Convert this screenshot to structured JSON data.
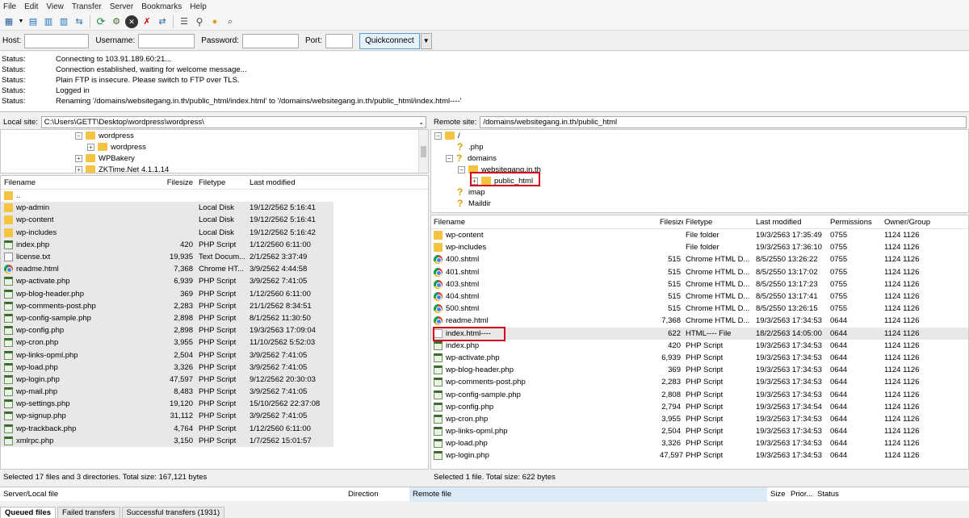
{
  "menu": [
    "File",
    "Edit",
    "View",
    "Transfer",
    "Server",
    "Bookmarks",
    "Help"
  ],
  "quickconnect": {
    "host_label": "Host:",
    "username_label": "Username:",
    "password_label": "Password:",
    "port_label": "Port:",
    "button_label": "Quickconnect",
    "host_value": "",
    "username_value": "",
    "password_value": "",
    "port_value": ""
  },
  "messages": [
    {
      "k": "Status:",
      "v": "Connecting to 103.91.189.60:21..."
    },
    {
      "k": "Status:",
      "v": "Connection established, waiting for welcome message..."
    },
    {
      "k": "Status:",
      "v": "Plain FTP is insecure. Please switch to FTP over TLS."
    },
    {
      "k": "Status:",
      "v": "Logged in"
    },
    {
      "k": "Status:",
      "v": "Renaming '/domains/websitegang.in.th/public_html/index.html' to '/domains/websitegang.in.th/public_html/index.html----'"
    }
  ],
  "local": {
    "site_label": "Local site:",
    "path": "C:\\Users\\GETT\\Desktop\\wordpress\\wordpress\\",
    "tree": [
      "wordpress",
      "wordpress",
      "WPBakery",
      "ZKTime.Net 4.1.1.14"
    ],
    "headers": {
      "name": "Filename",
      "size": "Filesize",
      "type": "Filetype",
      "modified": "Last modified"
    },
    "status": "Selected 17 files and 3 directories. Total size: 167,121 bytes"
  },
  "remote": {
    "site_label": "Remote site:",
    "path": "/domains/websitegang.in.th/public_html",
    "tree": [
      "/",
      ".php",
      "domains",
      "websitegang.in.th",
      "public_html",
      "imap",
      "Maildir"
    ],
    "headers": {
      "name": "Filename",
      "size": "Filesize",
      "type": "Filetype",
      "modified": "Last modified",
      "perm": "Permissions",
      "owner": "Owner/Group"
    },
    "status": "Selected 1 file. Total size: 622 bytes"
  },
  "queue": {
    "col_server": "Server/Local file",
    "col_direction": "Direction",
    "col_remote": "Remote file",
    "col_size": "Size",
    "col_priority": "Prior...",
    "col_status": "Status",
    "tabs": [
      "Queued files",
      "Failed transfers",
      "Successful transfers (1931)"
    ]
  }
}
